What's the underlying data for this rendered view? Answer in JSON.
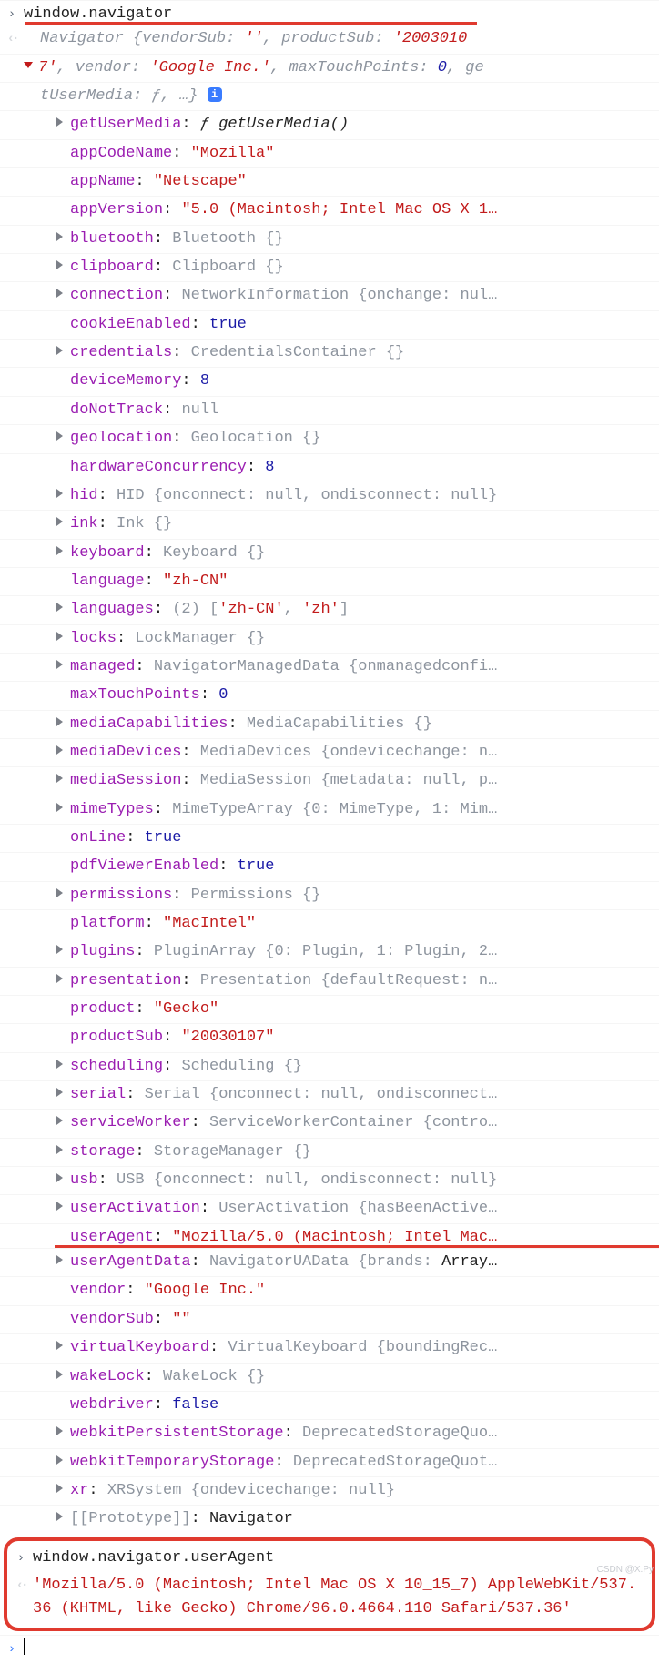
{
  "input1": "window.navigator",
  "header": {
    "l1_pre": "Navigator {vendorSub:",
    "l1_emptystr": "''",
    "l1_mid": ", productSub:",
    "l1_ps": "'2003010",
    "l2_pre": "7'",
    "l2_mid1": ", vendor:",
    "l2_vendor": "'Google Inc.'",
    "l2_mid2": ", maxTouchPoints:",
    "l2_mtp": "0",
    "l2_tail": ", ge",
    "l3_pre": "tUserMedia:",
    "l3_f": "ƒ",
    "l3_tail": ", …}",
    "info": "i"
  },
  "props": [
    {
      "expand": true,
      "k": "getUserMedia",
      "sep": ":",
      "ital_pre": "ƒ getUserMedia()",
      "valtype": "ital"
    },
    {
      "expand": false,
      "k": "appCodeName",
      "sep": ":",
      "val": "\"Mozilla\"",
      "valtype": "str"
    },
    {
      "expand": false,
      "k": "appName",
      "sep": ":",
      "val": "\"Netscape\"",
      "valtype": "str"
    },
    {
      "expand": false,
      "k": "appVersion",
      "sep": ":",
      "val": "\"5.0 (Macintosh; Intel Mac OS X 1…",
      "valtype": "str"
    },
    {
      "expand": true,
      "k": "bluetooth",
      "sep": ":",
      "pv": "Bluetooth {}"
    },
    {
      "expand": true,
      "k": "clipboard",
      "sep": ":",
      "pv": "Clipboard {}"
    },
    {
      "expand": true,
      "k": "connection",
      "sep": ":",
      "pv": "NetworkInformation {onchange: nul…"
    },
    {
      "expand": false,
      "k": "cookieEnabled",
      "sep": ":",
      "val": "true",
      "valtype": "num"
    },
    {
      "expand": true,
      "k": "credentials",
      "sep": ":",
      "pv": "CredentialsContainer {}"
    },
    {
      "expand": false,
      "k": "deviceMemory",
      "sep": ":",
      "val": "8",
      "valtype": "num"
    },
    {
      "expand": false,
      "k": "doNotTrack",
      "sep": ":",
      "pv": "null"
    },
    {
      "expand": true,
      "k": "geolocation",
      "sep": ":",
      "pv": "Geolocation {}"
    },
    {
      "expand": false,
      "k": "hardwareConcurrency",
      "sep": ":",
      "val": "8",
      "valtype": "num"
    },
    {
      "expand": true,
      "k": "hid",
      "sep": ":",
      "pv": "HID {onconnect: null, ondisconnect: null}"
    },
    {
      "expand": true,
      "k": "ink",
      "sep": ":",
      "pv": "Ink {}"
    },
    {
      "expand": true,
      "k": "keyboard",
      "sep": ":",
      "pv": "Keyboard {}"
    },
    {
      "expand": false,
      "k": "language",
      "sep": ":",
      "val": "\"zh-CN\"",
      "valtype": "str"
    },
    {
      "expand": true,
      "k": "languages",
      "sep": ":",
      "pv_pre": "(2) [",
      "arr": [
        {
          "s": "'zh-CN'"
        },
        {
          "s": "'zh'"
        }
      ],
      "pv_post": "]"
    },
    {
      "expand": true,
      "k": "locks",
      "sep": ":",
      "pv": "LockManager {}"
    },
    {
      "expand": true,
      "k": "managed",
      "sep": ":",
      "pv": "NavigatorManagedData {onmanagedconfi…"
    },
    {
      "expand": false,
      "k": "maxTouchPoints",
      "sep": ":",
      "val": "0",
      "valtype": "num"
    },
    {
      "expand": true,
      "k": "mediaCapabilities",
      "sep": ":",
      "pv": "MediaCapabilities {}"
    },
    {
      "expand": true,
      "k": "mediaDevices",
      "sep": ":",
      "pv": "MediaDevices {ondevicechange: n…"
    },
    {
      "expand": true,
      "k": "mediaSession",
      "sep": ":",
      "pv": "MediaSession {metadata: null, p…"
    },
    {
      "expand": true,
      "k": "mimeTypes",
      "sep": ":",
      "pv": "MimeTypeArray {0: MimeType, 1: Mim…"
    },
    {
      "expand": false,
      "k": "onLine",
      "sep": ":",
      "val": "true",
      "valtype": "num"
    },
    {
      "expand": false,
      "k": "pdfViewerEnabled",
      "sep": ":",
      "val": "true",
      "valtype": "num"
    },
    {
      "expand": true,
      "k": "permissions",
      "sep": ":",
      "pv": "Permissions {}"
    },
    {
      "expand": false,
      "k": "platform",
      "sep": ":",
      "val": "\"MacIntel\"",
      "valtype": "str"
    },
    {
      "expand": true,
      "k": "plugins",
      "sep": ":",
      "pv": "PluginArray {0: Plugin, 1: Plugin, 2…"
    },
    {
      "expand": true,
      "k": "presentation",
      "sep": ":",
      "pv": "Presentation {defaultRequest: n…"
    },
    {
      "expand": false,
      "k": "product",
      "sep": ":",
      "val": "\"Gecko\"",
      "valtype": "str"
    },
    {
      "expand": false,
      "k": "productSub",
      "sep": ":",
      "val": "\"20030107\"",
      "valtype": "str"
    },
    {
      "expand": true,
      "k": "scheduling",
      "sep": ":",
      "pv": "Scheduling {}"
    },
    {
      "expand": true,
      "k": "serial",
      "sep": ":",
      "pv": "Serial {onconnect: null, ondisconnect…"
    },
    {
      "expand": true,
      "k": "serviceWorker",
      "sep": ":",
      "pv": "ServiceWorkerContainer {contro…"
    },
    {
      "expand": true,
      "k": "storage",
      "sep": ":",
      "pv": "StorageManager {}"
    },
    {
      "expand": true,
      "k": "usb",
      "sep": ":",
      "pv": "USB {onconnect: null, ondisconnect: null}"
    },
    {
      "expand": true,
      "k": "userActivation",
      "sep": ":",
      "pv": "UserActivation {hasBeenActive…"
    },
    {
      "expand": false,
      "k": "userAgent",
      "sep": ":",
      "val": "\"Mozilla/5.0 (Macintosh; Intel Mac…",
      "valtype": "str",
      "mark": "redline"
    },
    {
      "expand": true,
      "k": "userAgentData",
      "sep": ":",
      "pv": "NavigatorUAData {brands: ",
      "trail_dark": "Array…"
    },
    {
      "expand": false,
      "k": "vendor",
      "sep": ":",
      "val": "\"Google Inc.\"",
      "valtype": "str"
    },
    {
      "expand": false,
      "k": "vendorSub",
      "sep": ":",
      "val": "\"\"",
      "valtype": "str"
    },
    {
      "expand": true,
      "k": "virtualKeyboard",
      "sep": ":",
      "pv": "VirtualKeyboard {boundingRec…"
    },
    {
      "expand": true,
      "k": "wakeLock",
      "sep": ":",
      "pv": "WakeLock {}"
    },
    {
      "expand": false,
      "k": "webdriver",
      "sep": ":",
      "val": "false",
      "valtype": "num"
    },
    {
      "expand": true,
      "k": "webkitPersistentStorage",
      "sep": ":",
      "pv": "DeprecatedStorageQuo…"
    },
    {
      "expand": true,
      "k": "webkitTemporaryStorage",
      "sep": ":",
      "pv": "DeprecatedStorageQuot…"
    },
    {
      "expand": true,
      "k": "xr",
      "sep": ":",
      "pv": "XRSystem {ondevicechange: null}"
    },
    {
      "expand": true,
      "kgrey": "[[Prototype]]",
      "sep": ":",
      "pv_dark": "Navigator"
    }
  ],
  "input2": "window.navigator.userAgent",
  "output2": "'Mozilla/5.0 (Macintosh; Intel Mac OS X 10_15_7) AppleWebKit/537.36 (KHTML, like Gecko) Chrome/96.0.4664.110 Safari/537.36'",
  "watermark": "CSDN @X.Py"
}
